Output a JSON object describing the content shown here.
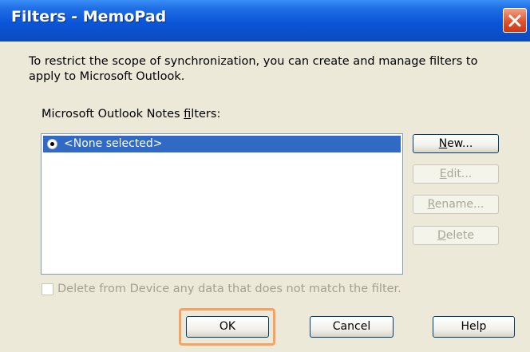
{
  "window": {
    "title": "Filters - MemoPad",
    "close_icon": "close-icon"
  },
  "intro": {
    "text": "To restrict the scope of synchronization, you can create and manage filters to apply to Microsoft Outlook."
  },
  "filters_label": {
    "before": "Microsoft Outlook Notes ",
    "accel": "f",
    "after": "ilters:"
  },
  "filters_list": {
    "items": [
      {
        "label": "<None selected>",
        "selected": true,
        "icon": "radio-selected-icon"
      }
    ]
  },
  "side_buttons": {
    "new": {
      "accel": "N",
      "rest": "ew...",
      "enabled": true
    },
    "edit": {
      "accel": "E",
      "rest": "dit...",
      "enabled": false
    },
    "rename": {
      "accel": "R",
      "rest": "ename...",
      "enabled": false
    },
    "delete": {
      "accel": "D",
      "rest": "elete",
      "enabled": false
    }
  },
  "delete_checkbox": {
    "label": "Delete from Device any data that does not match the filter.",
    "checked": false,
    "enabled": false
  },
  "footer": {
    "ok_label": "OK",
    "cancel_label": "Cancel",
    "help_label": "Help",
    "highlight_color": "#f6a362"
  },
  "colors": {
    "titlebar": "#0b55d8",
    "selection": "#316ac5",
    "dialog_bg": "#ece9d8",
    "close_button": "#e0522c"
  }
}
